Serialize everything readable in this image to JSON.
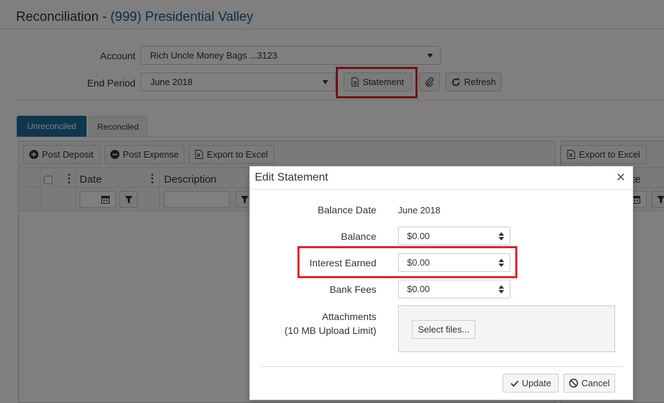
{
  "page": {
    "title_prefix": "Reconciliation - ",
    "title_link": "(999) Presidential Valley"
  },
  "filters": {
    "account_label": "Account",
    "account_value": "Rich Uncle Money Bags ...3123",
    "end_period_label": "End Period",
    "end_period_value": "June 2018",
    "statement_label": "Statement",
    "refresh_label": "Refresh"
  },
  "tabs": [
    {
      "label": "Unreconciled",
      "active": true
    },
    {
      "label": "Reconciled",
      "active": false
    }
  ],
  "toolbar": {
    "post_deposit": "Post Deposit",
    "post_expense": "Post Expense",
    "export_excel": "Export to Excel",
    "export_excel_right": "Export to Excel"
  },
  "grid": {
    "columns": [
      "Date",
      "Description"
    ],
    "right_column_partial": "te"
  },
  "dialog": {
    "title": "Edit Statement",
    "balance_date_label": "Balance Date",
    "balance_date_value": "June 2018",
    "balance_label": "Balance",
    "balance_value": "$0.00",
    "interest_label": "Interest Earned",
    "interest_value": "$0.00",
    "bank_fees_label": "Bank Fees",
    "bank_fees_value": "$0.00",
    "attachments_label": "Attachments",
    "upload_limit": "(10 MB Upload Limit)",
    "select_files": "Select files...",
    "update_label": "Update",
    "cancel_label": "Cancel"
  },
  "colors": {
    "link": "#1c5c8c",
    "tab_active": "#1f6ea0",
    "highlight": "#e3232a"
  }
}
